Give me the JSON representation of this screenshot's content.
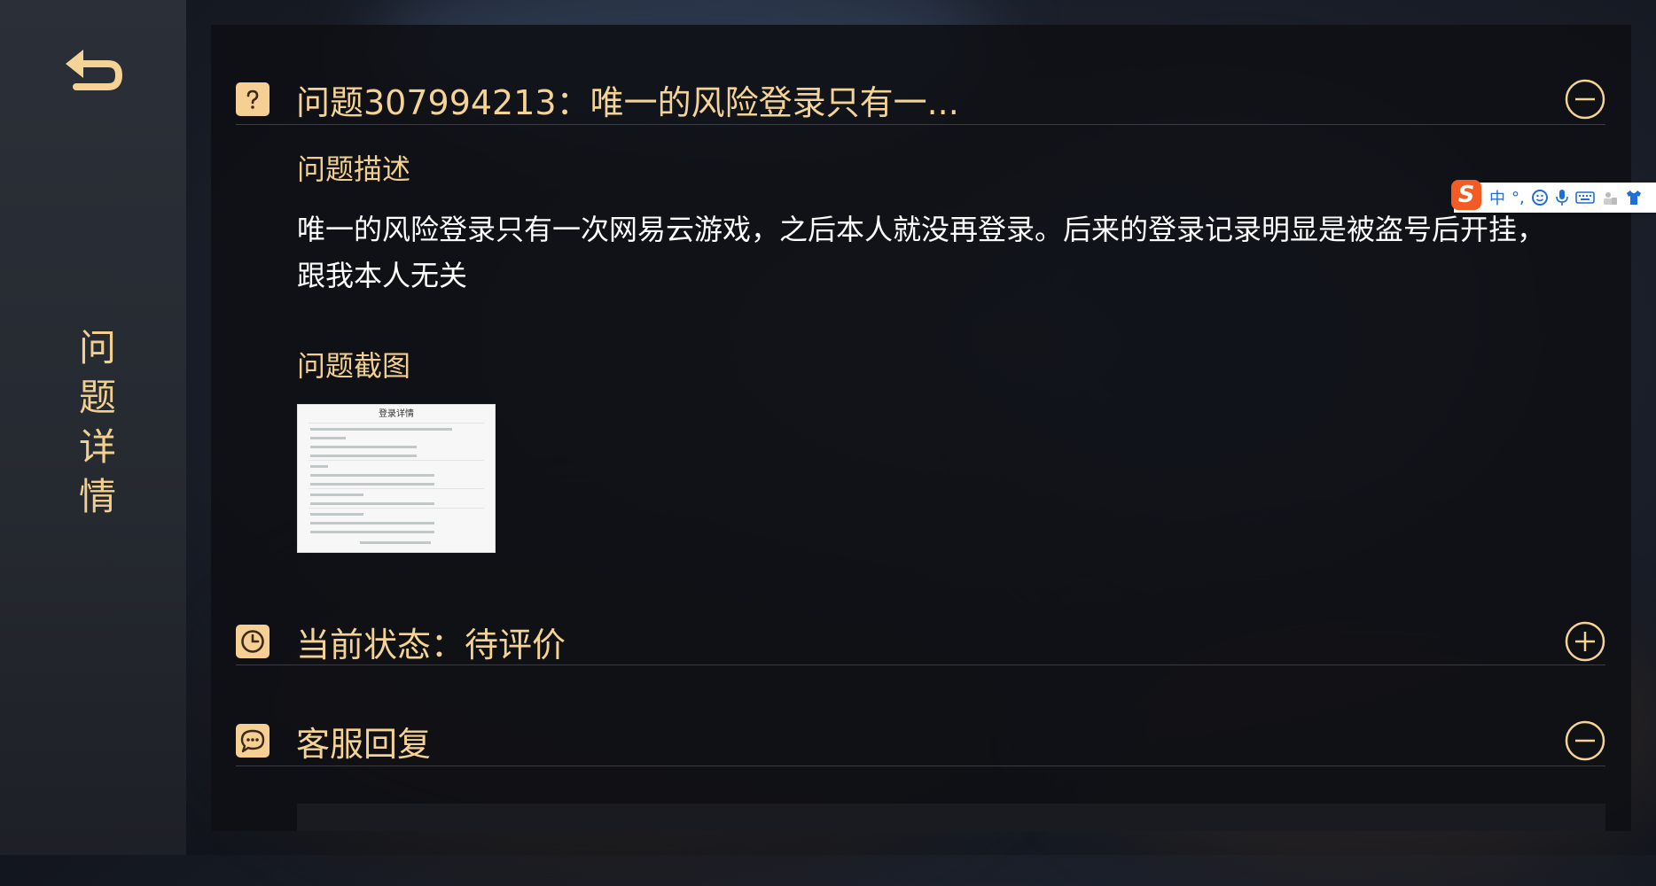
{
  "sidebar": {
    "title_chars": [
      "问",
      "题",
      "详",
      "情"
    ]
  },
  "question_section": {
    "title": "问题307994213：唯一的风险登录只有一...",
    "description_label": "问题描述",
    "description": "唯一的风险登录只有一次网易云游戏，之后本人就没再登录。后来的登录记录明显是被盗号后开挂，跟我本人无关",
    "screenshot_label": "问题截图",
    "screenshot_title": "登录详情"
  },
  "status_section": {
    "title": "当前状态：待评价"
  },
  "reply_section": {
    "title": "客服回复"
  },
  "ime": {
    "logo": "S",
    "mode": "中",
    "punct": "°,"
  },
  "colors": {
    "accent": "#f4d394",
    "icon_bg": "#f6cf94",
    "panel_bg": "#0e0f14",
    "text": "#ffffff"
  },
  "icons": {
    "back": "back-arrow-icon",
    "question": "question-mark-icon",
    "status": "clock-icon",
    "reply": "chat-bubble-icon",
    "collapse": "minus-circle-icon",
    "expand": "plus-circle-icon"
  }
}
